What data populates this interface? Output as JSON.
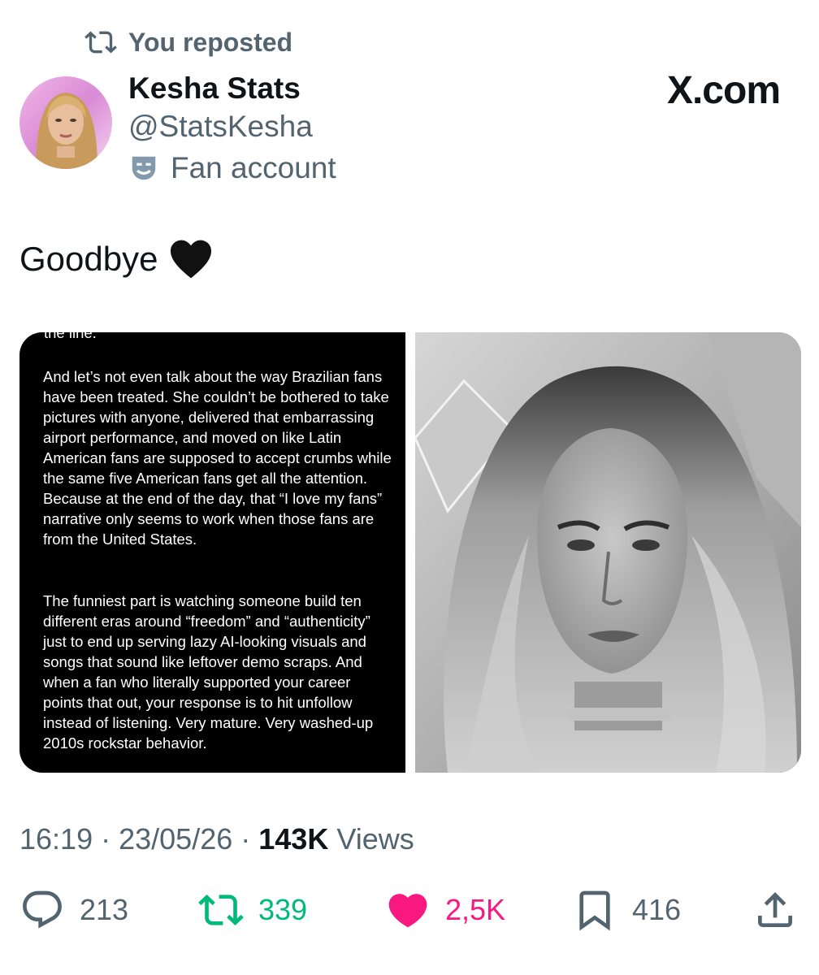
{
  "repost_banner": {
    "text": "You reposted"
  },
  "author": {
    "name": "Kesha Stats",
    "handle": "@StatsKesha",
    "label": "Fan account"
  },
  "brand": {
    "text": "X.com"
  },
  "tweet": {
    "text": "Goodbye",
    "emoji": "black-heart-icon"
  },
  "media": {
    "left_image_text": {
      "cut_line": "the line.",
      "paragraph_1": "And let’s not even talk about the way Brazilian fans have been treated. She couldn’t be bothered to take pictures with anyone, delivered that embarrassing airport performance, and moved on like Latin American fans are supposed to accept crumbs while the same five American fans get all the attention. Because at the end of the day, that “I love my fans” narrative only seems to work when those fans are from the United States.",
      "paragraph_2": "The funniest part is watching someone build ten different eras around “freedom” and “authenticity” just to end up serving lazy AI-looking visuals and songs that sound like leftover demo scraps. And when a fan who literally supported your career points that out, your response is to hit unfollow instead of listening. Very mature. Very washed-up 2010s rockstar behavior."
    },
    "right_image": "black-and-white portrait photo"
  },
  "meta": {
    "time": "16:19",
    "date": "23/05/26",
    "views_count": "143K",
    "views_label": "Views"
  },
  "actions": {
    "replies": "213",
    "reposts": "339",
    "likes": "2,5K",
    "bookmarks": "416"
  },
  "colors": {
    "secondary_text": "#536471",
    "primary_text": "#0f1419",
    "repost_green": "#00ba7c",
    "like_pink": "#f91880"
  }
}
